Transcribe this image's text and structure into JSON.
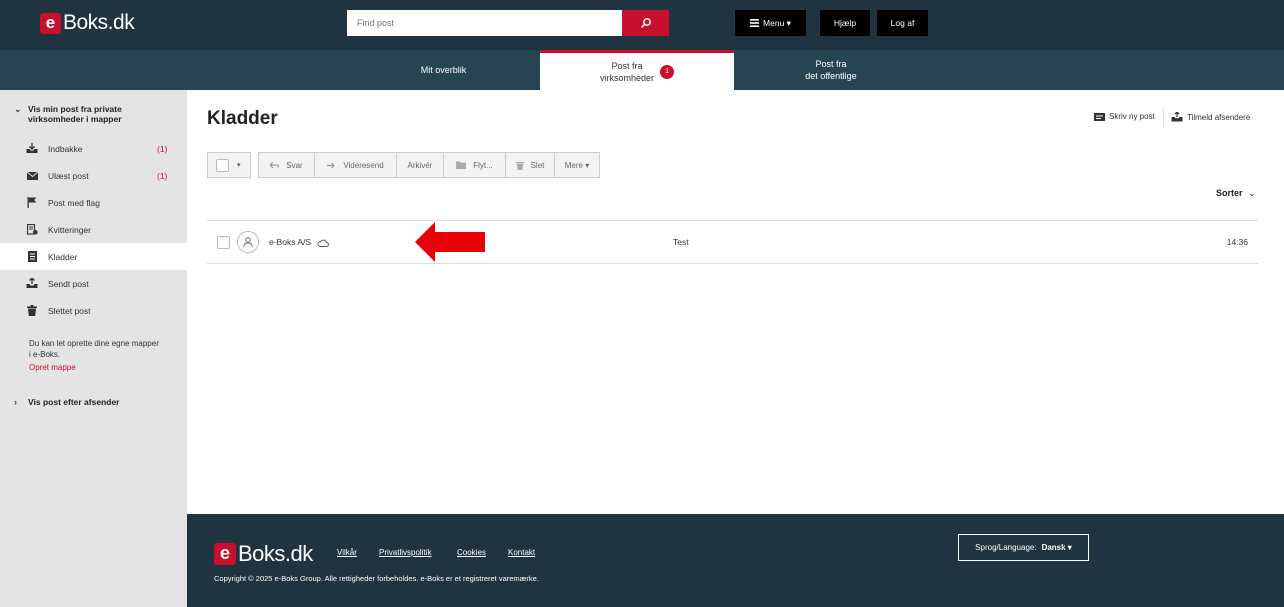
{
  "header": {
    "logo_e": "e",
    "logo_text": "Boks.dk",
    "search_placeholder": "Find post",
    "menu_label": "Menu ▾",
    "help_label": "Hjælp",
    "logout_label": "Log af"
  },
  "nav": {
    "tabs": [
      {
        "label": "Mit overblik",
        "active": false
      },
      {
        "label_line1": "Post fra",
        "label_line2": "virksomheder",
        "badge": "1",
        "active": true
      },
      {
        "label_line1": "Post fra",
        "label_line2": "det offentlige",
        "active": false
      }
    ]
  },
  "sidebar": {
    "group1_label": "Vis min post fra private virksomheder i mapper",
    "items": [
      {
        "label": "Indbakke",
        "count": "(1)",
        "icon": "inbox-icon"
      },
      {
        "label": "Ulæst post",
        "count": "(1)",
        "icon": "envelope-icon"
      },
      {
        "label": "Post med flag",
        "count": "",
        "icon": "flag-icon"
      },
      {
        "label": "Kvitteringer",
        "count": "",
        "icon": "receipt-icon"
      },
      {
        "label": "Kladder",
        "count": "",
        "icon": "document-icon",
        "active": true
      },
      {
        "label": "Sendt post",
        "count": "",
        "icon": "upload-icon"
      },
      {
        "label": "Slettet post",
        "count": "",
        "icon": "trash-icon"
      }
    ],
    "note": "Du kan let oprette dine egne mapper i e-Boks.",
    "create_folder": "Opret mappe",
    "group2_label": "Vis post efter afsender"
  },
  "main": {
    "title": "Kladder",
    "write_new": "Skriv ny post",
    "subscribe": "Tilmeld afsendere",
    "toolbar": {
      "reply": "Svar",
      "forward": "Videresend",
      "archive": "Arkivér",
      "move": "Flyt...",
      "delete": "Slet",
      "more": "Mere ▾"
    },
    "sort_label": "Sorter",
    "messages": [
      {
        "sender": "e-Boks A/S",
        "subject": "Test",
        "time": "14:36"
      }
    ]
  },
  "footer": {
    "links": [
      "Vilkår",
      "Privatlivspolitik",
      "Cookies",
      "Kontakt"
    ],
    "copyright": "Copyright © 2025 e-Boks Group. Alle rettigheder forbeholdes. e-Boks er et registreret varemærke.",
    "language_label": "Sprog/Language:",
    "language_value": "Dansk ▾"
  },
  "colors": {
    "header_bg": "#1f3340",
    "nav_bg": "#264452",
    "accent": "#c8102e",
    "sidebar_bg": "#e4e4e4"
  }
}
